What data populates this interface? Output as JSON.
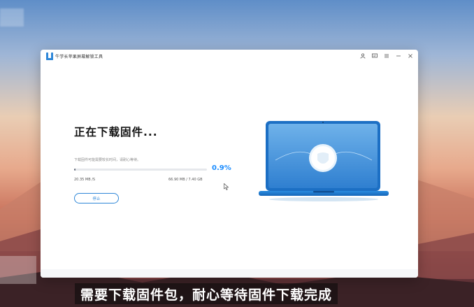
{
  "window": {
    "app_title": "牛学长苹果屏幕解锁工具",
    "titlebar_icons": [
      "user-icon",
      "feedback-icon",
      "menu-icon",
      "minimize-icon",
      "close-icon"
    ]
  },
  "download": {
    "heading": "正在下载固件...",
    "hint": "下载固件可能需要较长时间，请耐心等待。",
    "progress_percent": 0.9,
    "percent_text": "0.9%",
    "speed": "20.35 MB /S",
    "size": "66.90 MB / 7.40 GB",
    "stop_label": "停止"
  },
  "caption": {
    "text": "需要下载固件包，耐心等待固件下载完成"
  },
  "colors": {
    "accent": "#1a8cff",
    "button_border": "#2f87d8",
    "progress_fill": "#5b6473"
  }
}
